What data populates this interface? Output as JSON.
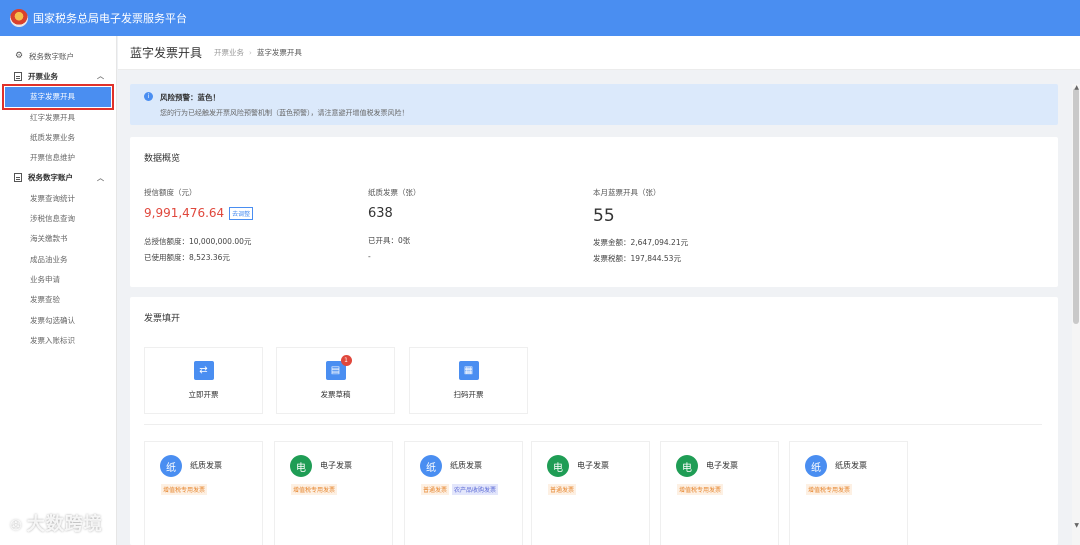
{
  "header": {
    "title": "国家税务总局电子发票服务平台"
  },
  "sidebar": {
    "items": [
      {
        "label": "税务数字账户",
        "type": "top",
        "icon": "gear-icon"
      },
      {
        "label": "开票业务",
        "type": "group"
      },
      {
        "label": "蓝字发票开具",
        "type": "active"
      },
      {
        "label": "红字发票开具",
        "type": "sub"
      },
      {
        "label": "纸质发票业务",
        "type": "sub"
      },
      {
        "label": "开票信息维护",
        "type": "sub"
      },
      {
        "label": "税务数字账户",
        "type": "group"
      },
      {
        "label": "发票查询统计",
        "type": "sub"
      },
      {
        "label": "涉税信息查询",
        "type": "sub"
      },
      {
        "label": "海关缴款书",
        "type": "sub"
      },
      {
        "label": "成品油业务",
        "type": "sub"
      },
      {
        "label": "业务申请",
        "type": "sub"
      },
      {
        "label": "发票查验",
        "type": "sub"
      },
      {
        "label": "发票勾选确认",
        "type": "sub"
      },
      {
        "label": "发票入账标识",
        "type": "sub"
      }
    ]
  },
  "page": {
    "title": "蓝字发票开具",
    "breadcrumb": [
      "开票业务",
      "蓝字发票开具"
    ]
  },
  "alert": {
    "title": "风险预警：蓝色！",
    "body": "您的行为已经触发开票风险预警机制（蓝色预警），请注意避开增值税发票风险！"
  },
  "overview": {
    "title": "数据概览",
    "credit": {
      "label": "授信额度（元）",
      "value": "9,991,476.64",
      "tag": "去调整",
      "total_label": "总授信额度：",
      "total_value": "10,000,000.00元",
      "used_label": "已使用额度：",
      "used_value": "8,523.36元"
    },
    "paper": {
      "label": "纸质发票（张）",
      "value": "638",
      "issued_label": "已开具：",
      "issued_value": "0张",
      "dash": "-"
    },
    "month": {
      "label": "本月蓝票开具（张）",
      "value": "55",
      "amount_label": "发票金额：",
      "amount_value": "2,647,094.21元",
      "tax_label": "发票税额：",
      "tax_value": "197,844.53元"
    }
  },
  "fill": {
    "title": "发票填开",
    "quick": [
      {
        "label": "立即开票",
        "icon": "issue-now-icon"
      },
      {
        "label": "发票草稿",
        "icon": "draft-icon",
        "badge": "1"
      },
      {
        "label": "扫码开票",
        "icon": "qr-code-icon"
      }
    ],
    "invoices": [
      {
        "char": "纸",
        "name": "纸质发票",
        "color": "blue",
        "tags": [
          "增值税专用发票"
        ]
      },
      {
        "char": "电",
        "name": "电子发票",
        "color": "green",
        "tags": [
          "增值税专用发票"
        ]
      },
      {
        "char": "纸",
        "name": "纸质发票",
        "color": "blue",
        "tags": [
          "普通发票",
          "农产品收购发票"
        ]
      },
      {
        "char": "电",
        "name": "电子发票",
        "color": "green",
        "tags": [
          "普通发票"
        ]
      },
      {
        "char": "电",
        "name": "电子发票",
        "color": "green",
        "tags": [
          "增值税专用发票"
        ]
      },
      {
        "char": "纸",
        "name": "纸质发票",
        "color": "blue",
        "tags": [
          "增值税专用发票"
        ]
      }
    ]
  },
  "watermark": {
    "text": "大数跨境"
  },
  "colors": {
    "primary": "#4a8ef1",
    "danger": "#e0473c",
    "success": "#1f9d55"
  }
}
